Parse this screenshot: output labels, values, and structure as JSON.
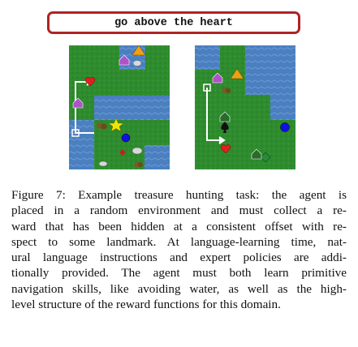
{
  "instruction": "go above the heart",
  "caption": {
    "lines": [
      "Figure 7:   Example treasure hunting task:  the agent is",
      "placed in a random environment and must collect a re-",
      "ward that has been hidden at a consistent offset with re-",
      "spect to some landmark.  At language-learning time, nat-",
      "ural language instructions and expert policies are addi-",
      "tionally provided.  The agent must both learn primitive",
      "navigation skills, like avoiding water, as well as the high-",
      "level structure of the reward functions for this domain."
    ]
  },
  "colors": {
    "grass": "#2e8b2e",
    "water": "#4a7fc0",
    "border": "#b02323",
    "path": "#ffffff",
    "heart": "#e02020",
    "star": "#f2e600",
    "triangle": "#f0a010",
    "circle": "#1010e0"
  },
  "icons": [
    "heart-icon",
    "star-icon",
    "triangle-icon",
    "circle-icon",
    "house-icon",
    "spade-icon",
    "diamond-icon",
    "rock-icon",
    "bush-icon"
  ]
}
